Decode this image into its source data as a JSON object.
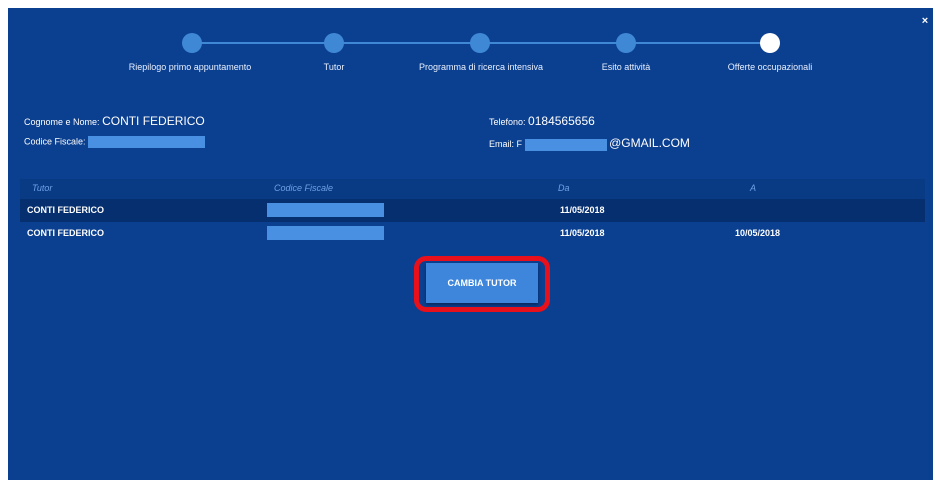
{
  "stepper": {
    "steps": [
      {
        "label": "Riepilogo primo appuntamento",
        "state": "done"
      },
      {
        "label": "Tutor",
        "state": "done"
      },
      {
        "label": "Programma di ricerca intensiva",
        "state": "done"
      },
      {
        "label": "Esito attività",
        "state": "done"
      },
      {
        "label": "Offerte occupazionali",
        "state": "current"
      }
    ]
  },
  "close_icon": "×",
  "person": {
    "name_label": "Cognome e Nome:",
    "name_value": "CONTI FEDERICO",
    "cf_label": "Codice Fiscale:",
    "phone_label": "Telefono:",
    "phone_value": "0184565656",
    "email_label": "Email:",
    "email_prefix": "F",
    "email_suffix": "@GMAIL.COM"
  },
  "tutor_table": {
    "columns": [
      "Tutor",
      "Codice Fiscale",
      "Da",
      "A"
    ],
    "rows": [
      {
        "tutor": "CONTI FEDERICO",
        "da": "11/05/2018",
        "a": ""
      },
      {
        "tutor": "CONTI FEDERICO",
        "da": "11/05/2018",
        "a": "10/05/2018"
      }
    ]
  },
  "actions": {
    "change_tutor": "CAMBIA TUTOR"
  },
  "colors": {
    "background": "#0b3f8f",
    "accent": "#3d86dc",
    "highlight": "#e8101b"
  }
}
